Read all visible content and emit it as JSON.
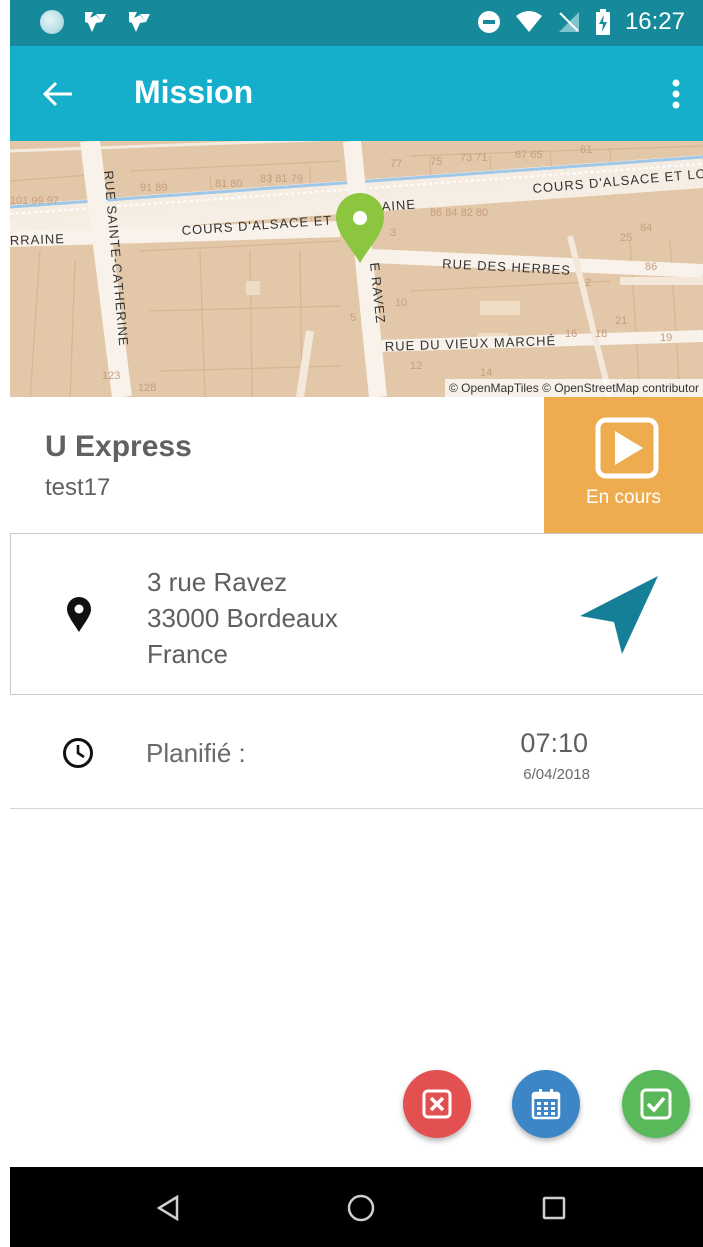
{
  "status_bar": {
    "time": "16:27",
    "icons_left": [
      "sync-dot-icon",
      "app-notification-icon",
      "app-notification-icon"
    ],
    "icons_right": [
      "do-not-disturb-icon",
      "wifi-icon",
      "no-sim-icon",
      "battery-charging-icon"
    ]
  },
  "app_bar": {
    "title": "Mission",
    "back_icon": "arrow-back-icon",
    "menu_icon": "more-vert-icon",
    "color": "#15aecb"
  },
  "map": {
    "streets": [
      "COURS D'ALSACE ET LO",
      "COURS D'ALSACE ET",
      "AINE",
      "RRAINE",
      "RUE SAINTE-CATHERINE",
      "RUE DES HERBES",
      "RUE DU VIEUX MARCHÉ",
      "E RAVEZ"
    ],
    "attribution": "© OpenMapTiles © OpenStreetMap contributor",
    "marker_icon": "map-marker-icon"
  },
  "mission": {
    "store_name": "U Express",
    "subtitle": "test17",
    "status": {
      "label": "En cours",
      "icon": "play-icon",
      "color": "#efac4e"
    }
  },
  "address": {
    "line1": "3 rue Ravez",
    "line2": "33000 Bordeaux",
    "line3": "France",
    "icon": "location-pin-icon",
    "navigate_icon": "navigate-arrow-icon"
  },
  "schedule": {
    "label": "Planifié :",
    "time": "07:10",
    "date": "6/04/2018",
    "icon": "clock-icon"
  },
  "actions": [
    {
      "name": "cancel",
      "icon": "close-box-icon",
      "color": "#e35050"
    },
    {
      "name": "calendar",
      "icon": "calendar-icon",
      "color": "#3c85c6"
    },
    {
      "name": "validate",
      "icon": "checkbox-icon",
      "color": "#59b859"
    }
  ],
  "nav_bar": {
    "buttons": [
      "back-triangle-icon",
      "home-circle-icon",
      "recents-square-icon"
    ]
  }
}
